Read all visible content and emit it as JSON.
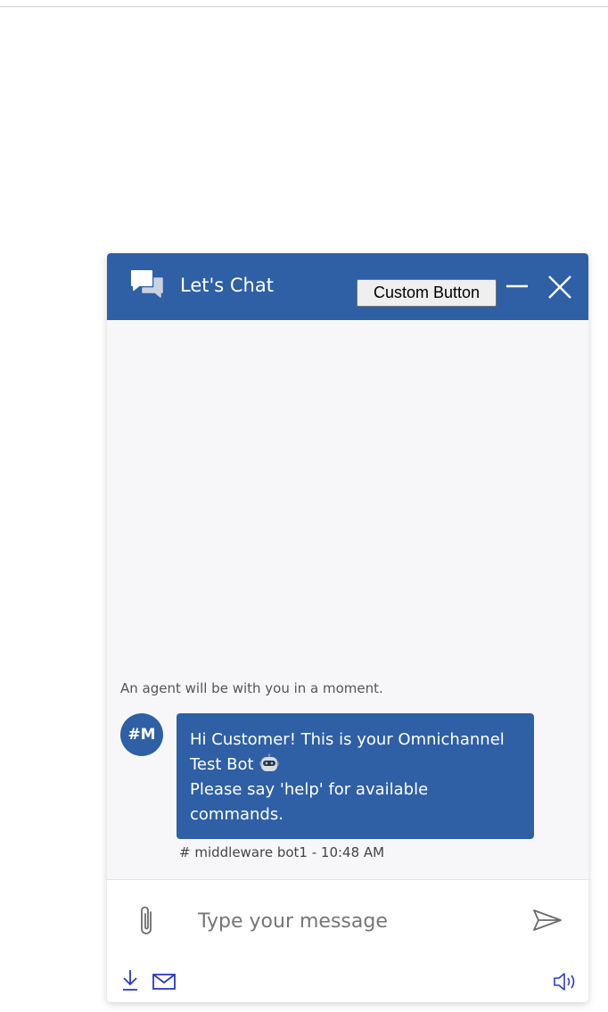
{
  "header": {
    "title": "Let's Chat",
    "custom_button_label": "Custom Button",
    "icons": {
      "chat": "chat-bubbles-icon",
      "minimize": "minimize-icon",
      "close": "close-icon"
    },
    "background_color": "#2f5fa5"
  },
  "conversation": {
    "system_message": "An agent will be with you in a moment.",
    "messages": [
      {
        "avatar_initials": "#M",
        "lines": [
          "Hi Customer! This is your Omnichannel",
          "Test Bot",
          "Please say 'help' for available",
          "commands."
        ],
        "emoji_icon": "robot-face-icon",
        "sender": "# middleware bot1",
        "time": "10:48 AM",
        "timestamp": "# middleware bot1 - 10:48 AM"
      }
    ]
  },
  "composer": {
    "placeholder": "Type your message",
    "value": "",
    "icons": {
      "attach": "paperclip-icon",
      "send": "send-icon",
      "download": "download-icon",
      "email": "email-icon",
      "audio": "speaker-icon"
    }
  },
  "colors": {
    "brand": "#2f5fa5",
    "panel_background": "#f7f7f9",
    "footer_icon": "#2b39c7"
  }
}
